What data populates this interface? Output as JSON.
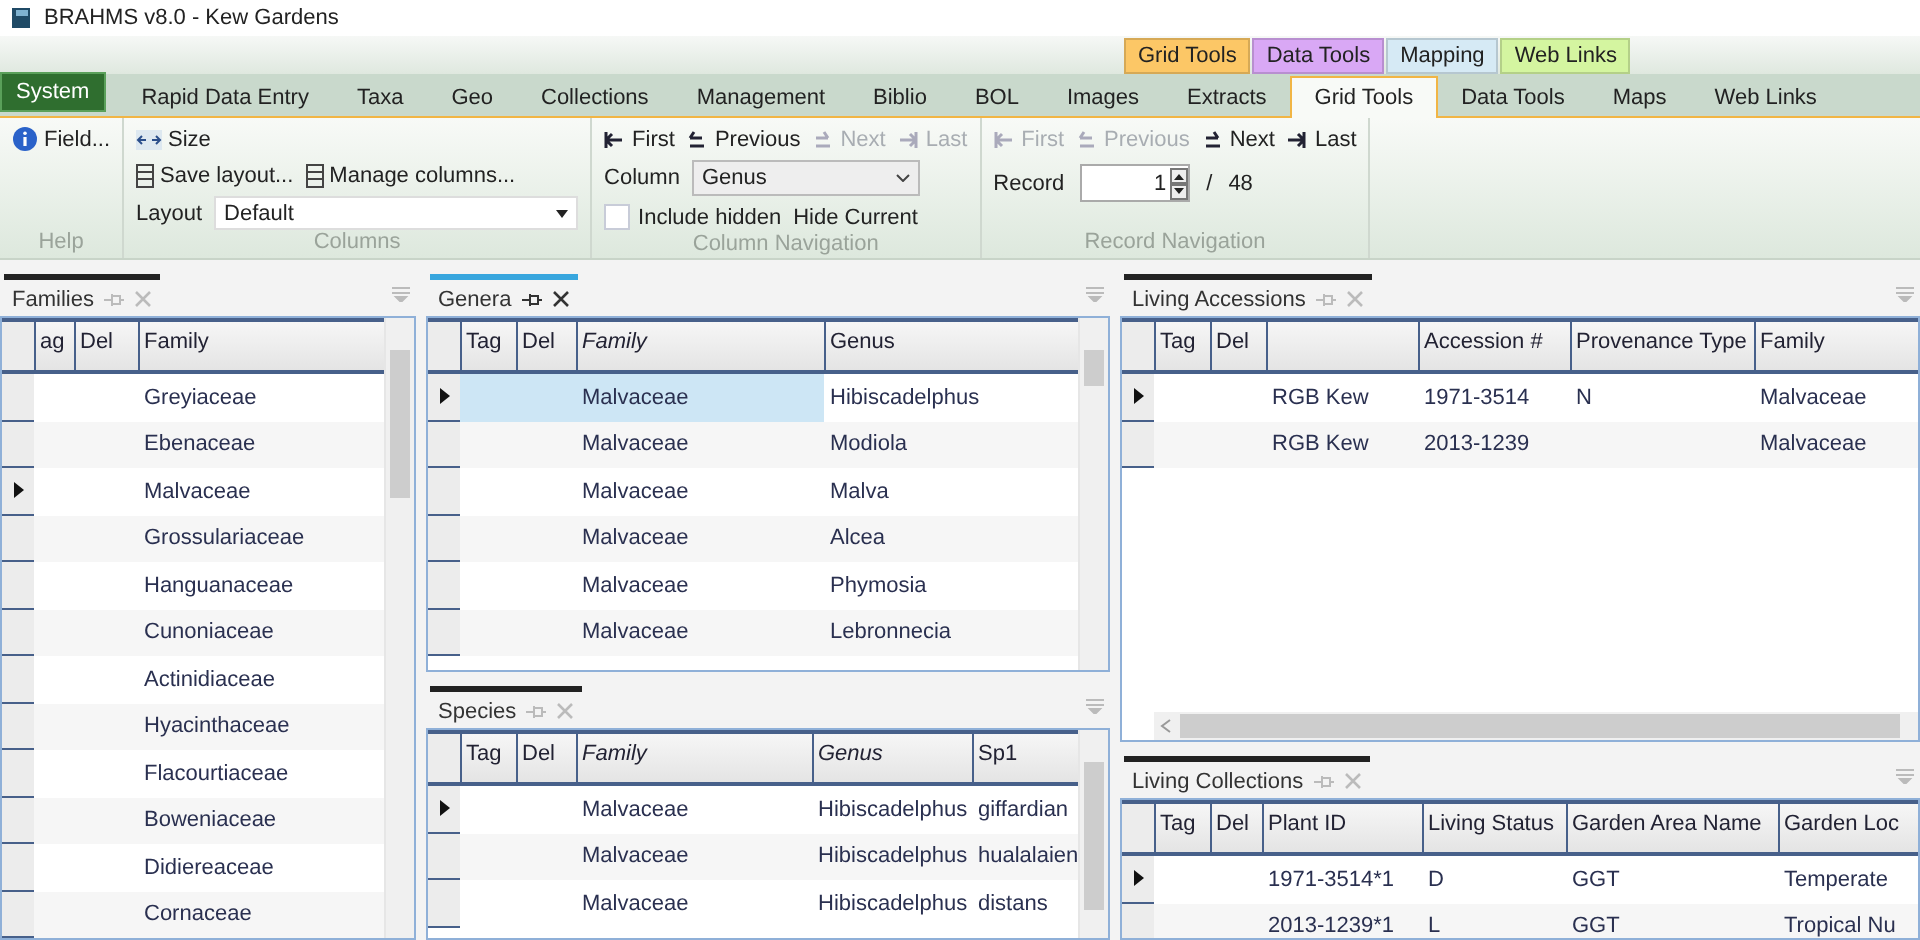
{
  "window": {
    "title": "BRAHMS v8.0 - Kew Gardens"
  },
  "context_tabs": [
    {
      "label": "Grid Tools",
      "color": "#fcc766"
    },
    {
      "label": "Data Tools",
      "color": "#d9a8f5"
    },
    {
      "label": "Mapping",
      "color": "#d6eaf5"
    },
    {
      "label": "Web Links",
      "color": "#d4f5a0"
    }
  ],
  "tabs": [
    {
      "label": "System",
      "kind": "system",
      "selected": false
    },
    {
      "label": "Rapid Data Entry",
      "kind": "tab",
      "selected": false
    },
    {
      "label": "Taxa",
      "kind": "tab",
      "selected": false
    },
    {
      "label": "Geo",
      "kind": "tab",
      "selected": false
    },
    {
      "label": "Collections",
      "kind": "tab",
      "selected": false
    },
    {
      "label": "Management",
      "kind": "tab",
      "selected": false
    },
    {
      "label": "Biblio",
      "kind": "tab",
      "selected": false
    },
    {
      "label": "BOL",
      "kind": "tab",
      "selected": false
    },
    {
      "label": "Images",
      "kind": "tab",
      "selected": false
    },
    {
      "label": "Extracts",
      "kind": "tab",
      "selected": false
    },
    {
      "label": "Grid Tools",
      "kind": "tab",
      "selected": true
    },
    {
      "label": "Data Tools",
      "kind": "tab",
      "selected": false
    },
    {
      "label": "Maps",
      "kind": "tab",
      "selected": false
    },
    {
      "label": "Web Links",
      "kind": "tab",
      "selected": false
    }
  ],
  "ribbon": {
    "help": {
      "label": "Help",
      "field_button": "Field..."
    },
    "columns": {
      "label": "Columns",
      "size_button": "Size",
      "save_layout": "Save layout...",
      "manage_columns": "Manage columns...",
      "layout_label": "Layout",
      "layout_value": "Default"
    },
    "column_navigation": {
      "label": "Column Navigation",
      "buttons": [
        {
          "label": "First",
          "kind": "first",
          "disabled": false
        },
        {
          "label": "Previous",
          "kind": "previous",
          "disabled": false
        },
        {
          "label": "Next",
          "kind": "next",
          "disabled": true
        },
        {
          "label": "Last",
          "kind": "last",
          "disabled": true
        }
      ],
      "column_label": "Column",
      "column_value": "Genus",
      "include_hidden": {
        "label": "Include hidden",
        "checked": false
      },
      "hide_current": "Hide Current"
    },
    "record_navigation": {
      "label": "Record Navigation",
      "buttons": [
        {
          "label": "First",
          "kind": "first",
          "disabled": true
        },
        {
          "label": "Previous",
          "kind": "previous",
          "disabled": true
        },
        {
          "label": "Next",
          "kind": "next",
          "disabled": false
        },
        {
          "label": "Last",
          "kind": "last",
          "disabled": false
        }
      ],
      "record_label": "Record",
      "record_value": "1",
      "separator": "/",
      "total": "48"
    }
  },
  "grids": [
    {
      "title": "Families",
      "active": false,
      "columns": [
        {
          "label": "ag",
          "italic": false
        },
        {
          "label": "Del",
          "italic": false
        },
        {
          "label": "Family",
          "italic": false
        }
      ],
      "rows": [
        {
          "cells": [
            "",
            "",
            "Greyiaceae"
          ],
          "current": false,
          "selected": false
        },
        {
          "cells": [
            "",
            "",
            "Ebenaceae"
          ],
          "current": false,
          "selected": false
        },
        {
          "cells": [
            "",
            "",
            "Malvaceae"
          ],
          "current": true,
          "selected": false
        },
        {
          "cells": [
            "",
            "",
            "Grossulariaceae"
          ],
          "current": false,
          "selected": false
        },
        {
          "cells": [
            "",
            "",
            "Hanguanaceae"
          ],
          "current": false,
          "selected": false
        },
        {
          "cells": [
            "",
            "",
            "Cunoniaceae"
          ],
          "current": false,
          "selected": false
        },
        {
          "cells": [
            "",
            "",
            "Actinidiaceae"
          ],
          "current": false,
          "selected": false
        },
        {
          "cells": [
            "",
            "",
            "Hyacinthaceae"
          ],
          "current": false,
          "selected": false
        },
        {
          "cells": [
            "",
            "",
            "Flacourtiaceae"
          ],
          "current": false,
          "selected": false
        },
        {
          "cells": [
            "",
            "",
            "Boweniaceae"
          ],
          "current": false,
          "selected": false
        },
        {
          "cells": [
            "",
            "",
            "Didiereaceae"
          ],
          "current": false,
          "selected": false
        },
        {
          "cells": [
            "",
            "",
            "Cornaceae"
          ],
          "current": false,
          "selected": false
        }
      ]
    },
    {
      "title": "Genera",
      "active": true,
      "columns": [
        {
          "label": "Tag",
          "italic": false
        },
        {
          "label": "Del",
          "italic": false
        },
        {
          "label": "Family",
          "italic": true
        },
        {
          "label": "Genus",
          "italic": false
        }
      ],
      "rows": [
        {
          "cells": [
            "",
            "",
            "Malvaceae",
            "Hibiscadelphus"
          ],
          "current": true,
          "selected": true
        },
        {
          "cells": [
            "",
            "",
            "Malvaceae",
            "Modiola"
          ],
          "current": false,
          "selected": false
        },
        {
          "cells": [
            "",
            "",
            "Malvaceae",
            "Malva"
          ],
          "current": false,
          "selected": false
        },
        {
          "cells": [
            "",
            "",
            "Malvaceae",
            "Alcea"
          ],
          "current": false,
          "selected": false
        },
        {
          "cells": [
            "",
            "",
            "Malvaceae",
            "Phymosia"
          ],
          "current": false,
          "selected": false
        },
        {
          "cells": [
            "",
            "",
            "Malvaceae",
            "Lebronnecia"
          ],
          "current": false,
          "selected": false
        }
      ]
    },
    {
      "title": "Species",
      "active": false,
      "columns": [
        {
          "label": "Tag",
          "italic": false
        },
        {
          "label": "Del",
          "italic": false
        },
        {
          "label": "Family",
          "italic": true
        },
        {
          "label": "Genus",
          "italic": true
        },
        {
          "label": "Sp1",
          "italic": false
        }
      ],
      "rows": [
        {
          "cells": [
            "",
            "",
            "Malvaceae",
            "Hibiscadelphus",
            "giffardian"
          ],
          "current": true,
          "selected": false
        },
        {
          "cells": [
            "",
            "",
            "Malvaceae",
            "Hibiscadelphus",
            "hualalaien"
          ],
          "current": false,
          "selected": false
        },
        {
          "cells": [
            "",
            "",
            "Malvaceae",
            "Hibiscadelphus",
            "distans"
          ],
          "current": false,
          "selected": false
        }
      ]
    },
    {
      "title": "Living Accessions",
      "active": false,
      "columns": [
        {
          "label": "Tag",
          "italic": false
        },
        {
          "label": "Del",
          "italic": false
        },
        {},
        {
          "label": "Accession #",
          "italic": false
        },
        {
          "label": "Provenance Type",
          "italic": false
        },
        {
          "label": "Family",
          "italic": false
        }
      ],
      "rows": [
        {
          "cells": [
            "",
            "",
            "RGB Kew",
            "1971-3514",
            "N",
            "Malvaceae"
          ],
          "current": true,
          "selected": false
        },
        {
          "cells": [
            "",
            "",
            "RGB Kew",
            "2013-1239",
            "",
            "Malvaceae"
          ],
          "current": false,
          "selected": false
        }
      ]
    },
    {
      "title": "Living Collections",
      "active": false,
      "columns": [
        {
          "label": "Tag",
          "italic": false
        },
        {
          "label": "Del",
          "italic": false
        },
        {
          "label": "Plant ID",
          "italic": false
        },
        {
          "label": "Living Status",
          "italic": false
        },
        {
          "label": "Garden Area Name",
          "italic": false
        },
        {
          "label": "Garden Loc",
          "italic": false
        }
      ],
      "rows": [
        {
          "cells": [
            "",
            "",
            "1971-3514*1",
            "D",
            "GGT",
            "Temperate"
          ],
          "current": true,
          "selected": false
        },
        {
          "cells": [
            "",
            "",
            "2013-1239*1",
            "L",
            "GGT",
            "Tropical Nu"
          ],
          "current": false,
          "selected": false
        }
      ]
    }
  ]
}
